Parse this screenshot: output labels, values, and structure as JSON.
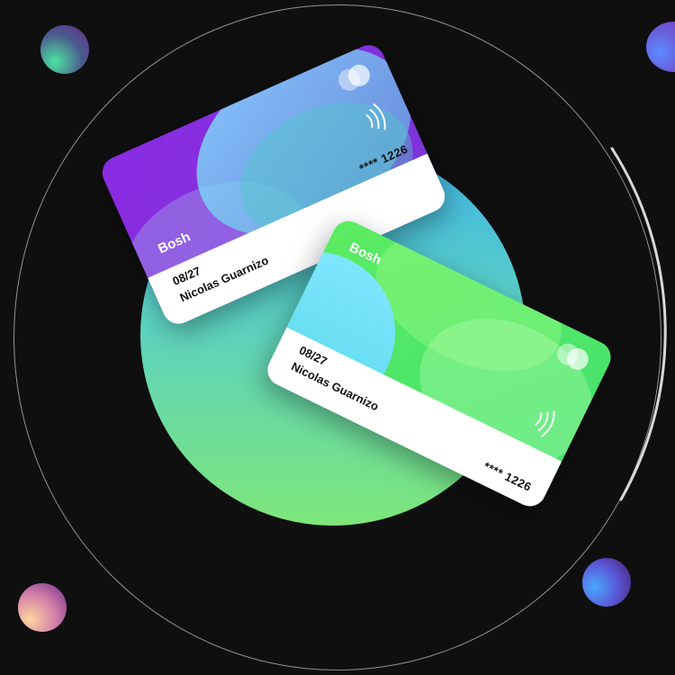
{
  "cards": [
    {
      "brand": "Bosh",
      "number": "**** 1226",
      "expiry": "08/27",
      "holder": "Nicolas Guarnizo",
      "theme": "purple",
      "colors": {
        "base": "#8a2be2",
        "accent": "#7fdcff"
      }
    },
    {
      "brand": "Bosh",
      "number": "**** 1226",
      "expiry": "08/27",
      "holder": "Nicolas Guarnizo",
      "theme": "green",
      "colors": {
        "base": "#4be36a",
        "accent": "#7ee6ff"
      }
    }
  ],
  "icons": {
    "contactless": "contactless-icon",
    "card_chip": "card-logo-icon"
  },
  "colors": {
    "background": "#0f0f10",
    "circle_gradient": [
      "#3fb4e8",
      "#7ee67a"
    ]
  }
}
